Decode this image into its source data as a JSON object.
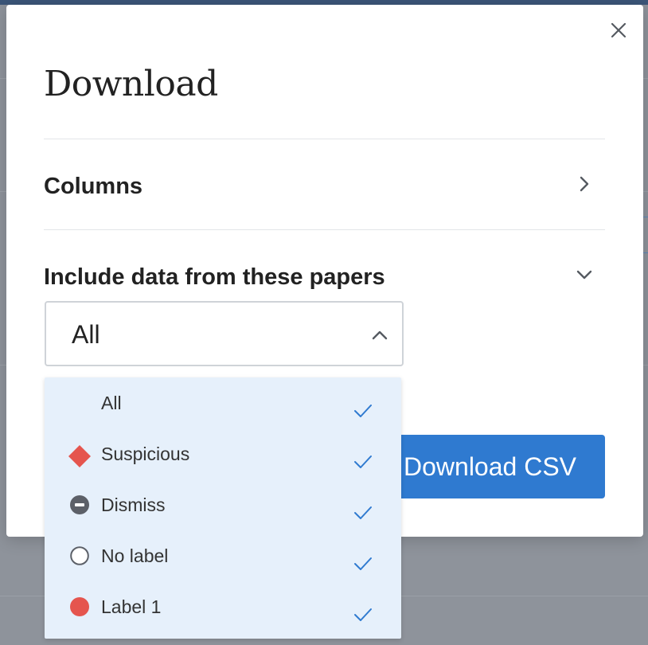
{
  "dialog": {
    "title": "Download",
    "close_icon": "close-icon"
  },
  "sections": {
    "columns": {
      "label": "Columns",
      "icon": "chevron-right-icon"
    },
    "papers": {
      "label": "Include data from these papers",
      "icon": "chevron-down-icon"
    }
  },
  "paper_select": {
    "selected": "All",
    "icon": "chevron-up-icon",
    "options": [
      {
        "label": "All",
        "icon": "none",
        "checked": true
      },
      {
        "label": "Suspicious",
        "icon": "red-diamond-icon",
        "checked": true
      },
      {
        "label": "Dismiss",
        "icon": "dismiss-minus-icon",
        "checked": true
      },
      {
        "label": "No label",
        "icon": "empty-circle-icon",
        "checked": true
      },
      {
        "label": "Label 1",
        "icon": "red-circle-icon",
        "checked": true
      }
    ]
  },
  "actions": {
    "download_label": "Download CSV"
  },
  "colors": {
    "primary": "#2f7ad0",
    "dropdown_bg": "#e6f0fb",
    "suspicious": "#e5554e",
    "label1": "#e5554e",
    "dismiss": "#5c6068",
    "check": "#2f7ad0"
  }
}
